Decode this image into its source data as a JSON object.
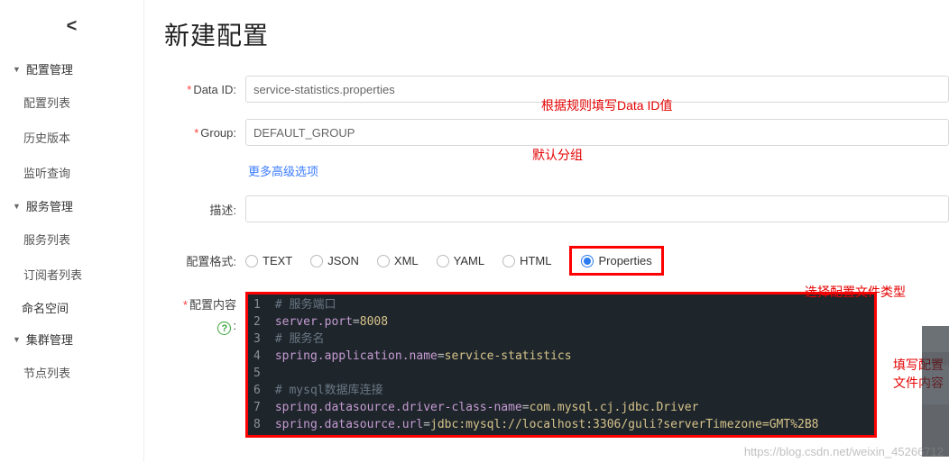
{
  "sidebar": {
    "groups": [
      {
        "title": "配置管理",
        "items": [
          "配置列表",
          "历史版本",
          "监听查询"
        ]
      },
      {
        "title": "服务管理",
        "items": [
          "服务列表",
          "订阅者列表"
        ]
      }
    ],
    "single_items": [
      "命名空间"
    ],
    "groups2": [
      {
        "title": "集群管理",
        "items": [
          "节点列表"
        ]
      }
    ]
  },
  "page": {
    "title": "新建配置"
  },
  "form": {
    "data_id": {
      "label": "Data ID:",
      "value": "service-statistics.properties"
    },
    "group": {
      "label": "Group:",
      "value": "DEFAULT_GROUP"
    },
    "more_link": "更多高级选项",
    "desc": {
      "label": "描述:",
      "value": ""
    },
    "format": {
      "label": "配置格式:",
      "options": [
        "TEXT",
        "JSON",
        "XML",
        "YAML",
        "HTML",
        "Properties"
      ],
      "selected": "Properties"
    },
    "content": {
      "label": "配置内容",
      "help_colon": ":"
    }
  },
  "annotations": {
    "data_id": "根据规则填写Data ID值",
    "group": "默认分组",
    "format": "选择配置文件类型",
    "content": "填写配置文件内容"
  },
  "editor": {
    "lines": [
      {
        "n": 1,
        "type": "cmt",
        "text": "# 服务端口"
      },
      {
        "n": 2,
        "type": "kv",
        "key": "server.port",
        "val": "8008"
      },
      {
        "n": 3,
        "type": "cmt",
        "text": "# 服务名"
      },
      {
        "n": 4,
        "type": "kv",
        "key": "spring.application.name",
        "val": "service-statistics"
      },
      {
        "n": 5,
        "type": "blank"
      },
      {
        "n": 6,
        "type": "cmt",
        "text": "# mysql数据库连接"
      },
      {
        "n": 7,
        "type": "kv",
        "key": "spring.datasource.driver-class-name",
        "val": "com.mysql.cj.jdbc.Driver"
      },
      {
        "n": 8,
        "type": "kv",
        "key": "spring.datasource.url",
        "val": "jdbc:mysql://localhost:3306/guli?serverTimezone=GMT%2B8"
      }
    ]
  },
  "watermark": "https://blog.csdn.net/weixin_45266712"
}
